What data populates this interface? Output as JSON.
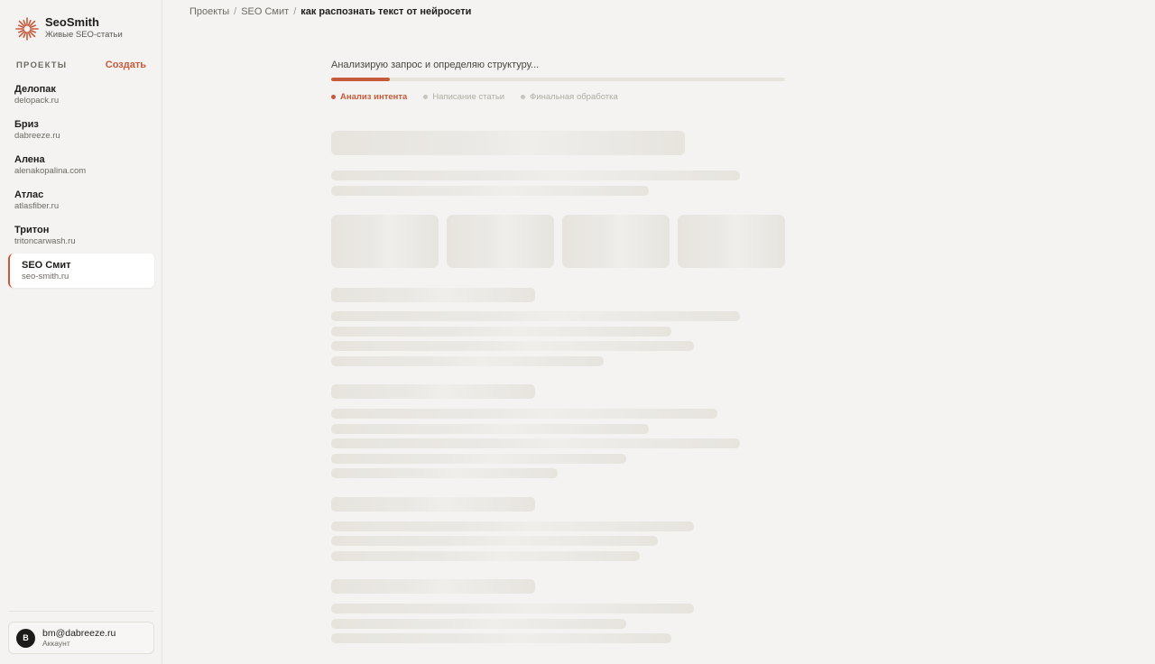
{
  "brand": {
    "name": "SeoSmith",
    "tagline": "Живые SEO-статьи"
  },
  "sidebar": {
    "section_label": "ПРОЕКТЫ",
    "create_label": "Создать",
    "projects": [
      {
        "name": "Делопак",
        "domain": "delopack.ru",
        "active": false
      },
      {
        "name": "Бриз",
        "domain": "dabreeze.ru",
        "active": false
      },
      {
        "name": "Алена",
        "domain": "alenakopalina.com",
        "active": false
      },
      {
        "name": "Атлас",
        "domain": "atlasfiber.ru",
        "active": false
      },
      {
        "name": "Тритон",
        "domain": "tritoncarwash.ru",
        "active": false
      },
      {
        "name": "SEO Смит",
        "domain": "seo-smith.ru",
        "active": true
      }
    ]
  },
  "account": {
    "initial": "B",
    "email": "bm@dabreeze.ru",
    "subtitle": "Аккаунт"
  },
  "breadcrumb": {
    "items": [
      "Проекты",
      "SEO Смит"
    ],
    "current": "как распознать текст от нейросети"
  },
  "progress": {
    "status_text": "Анализирую запрос и определяю структуру...",
    "fraction": 0.13,
    "accent_color": "#c75a3a",
    "steps": [
      {
        "label": "Анализ интента",
        "active": true
      },
      {
        "label": "Написание статьи",
        "active": false
      },
      {
        "label": "Финальная обработка",
        "active": false
      }
    ]
  }
}
